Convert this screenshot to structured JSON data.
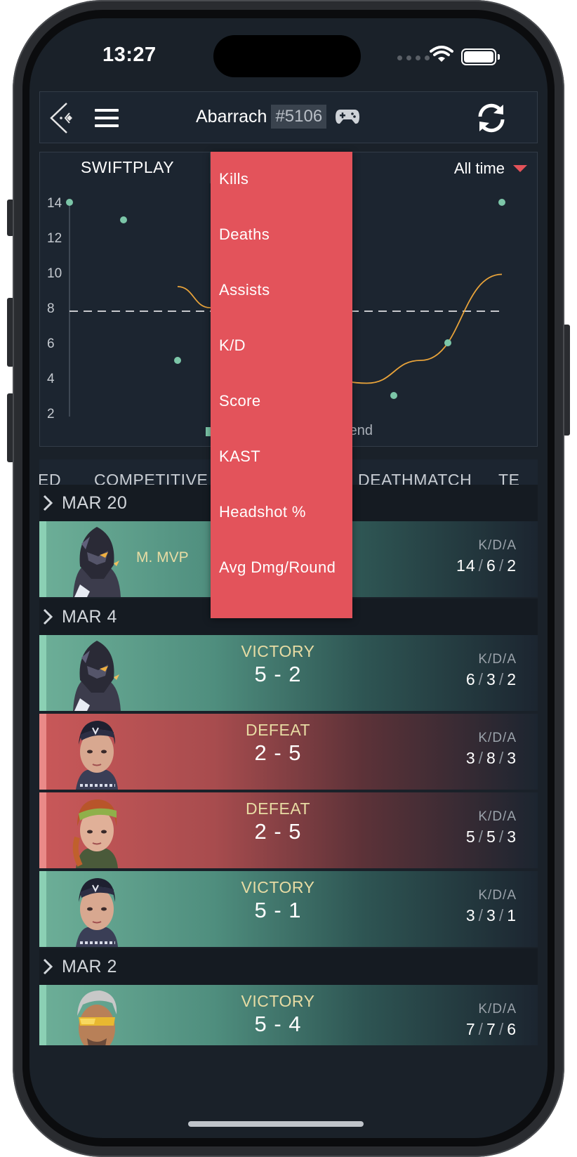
{
  "status_bar": {
    "time": "13:27"
  },
  "header": {
    "player_name": "Abarrach",
    "player_tag": "#5106",
    "icons": [
      "back-logo-icon",
      "menu-icon",
      "gamepad-icon",
      "refresh-icon"
    ]
  },
  "chart_panel": {
    "mode_label": "SWIFTPLAY",
    "time_filter": "All time",
    "legend_trend_label": "rend"
  },
  "chart_data": {
    "type": "scatter",
    "y_ticks": [
      2,
      4,
      6,
      8,
      10,
      12,
      14
    ],
    "ylim": [
      1,
      15
    ],
    "points": [
      {
        "x": 0,
        "y": 14
      },
      {
        "x": 1,
        "y": 13
      },
      {
        "x": 2,
        "y": 5
      },
      {
        "x": 6,
        "y": 3
      },
      {
        "x": 7,
        "y": 6
      },
      {
        "x": 8,
        "y": 14
      }
    ],
    "average_line": 7.8,
    "trend_curve": [
      {
        "x": 2,
        "y": 9.2
      },
      {
        "x": 2.6,
        "y": 8
      },
      {
        "x": 5.5,
        "y": 3.7
      },
      {
        "x": 6.5,
        "y": 5
      },
      {
        "x": 8,
        "y": 9.9
      }
    ],
    "colors": {
      "points": "#7cc6a8",
      "trend": "#e8a33a",
      "average": "#ffffff"
    }
  },
  "tabs": [
    "ED",
    "COMPETITIVE",
    "DEATHMATCH",
    "TE"
  ],
  "dropdown": {
    "items": [
      "Kills",
      "Deaths",
      "Assists",
      "K/D",
      "Score",
      "KAST",
      "Headshot %",
      "Avg Dmg/Round"
    ]
  },
  "dates": [
    "MAR 20",
    "MAR 4",
    "MAR 2"
  ],
  "matches": [
    {
      "result": "",
      "score": "",
      "badge": "M. MVP",
      "kda_label": "K/D/A",
      "k": "14",
      "d": "6",
      "a": "2",
      "outcome": "win",
      "agent_icon": "helmet-agent-icon"
    },
    {
      "result": "VICTORY",
      "score": "5 - 2",
      "badge": "",
      "kda_label": "K/D/A",
      "k": "6",
      "d": "3",
      "a": "2",
      "outcome": "win",
      "agent_icon": "helmet-agent-icon"
    },
    {
      "result": "DEFEAT",
      "score": "2 - 5",
      "badge": "",
      "kda_label": "K/D/A",
      "k": "3",
      "d": "8",
      "a": "3",
      "outcome": "loss",
      "agent_icon": "bandana-agent-icon"
    },
    {
      "result": "DEFEAT",
      "score": "2 - 5",
      "badge": "",
      "kda_label": "K/D/A",
      "k": "5",
      "d": "5",
      "a": "3",
      "outcome": "loss",
      "agent_icon": "green-bandana-agent-icon"
    },
    {
      "result": "VICTORY",
      "score": "5 - 1",
      "badge": "",
      "kda_label": "K/D/A",
      "k": "3",
      "d": "3",
      "a": "1",
      "outcome": "win",
      "agent_icon": "bandana-agent-icon"
    },
    {
      "result": "VICTORY",
      "score": "5 - 4",
      "badge": "",
      "kda_label": "K/D/A",
      "k": "7",
      "d": "7",
      "a": "6",
      "outcome": "win",
      "agent_icon": "goggles-agent-icon"
    }
  ]
}
